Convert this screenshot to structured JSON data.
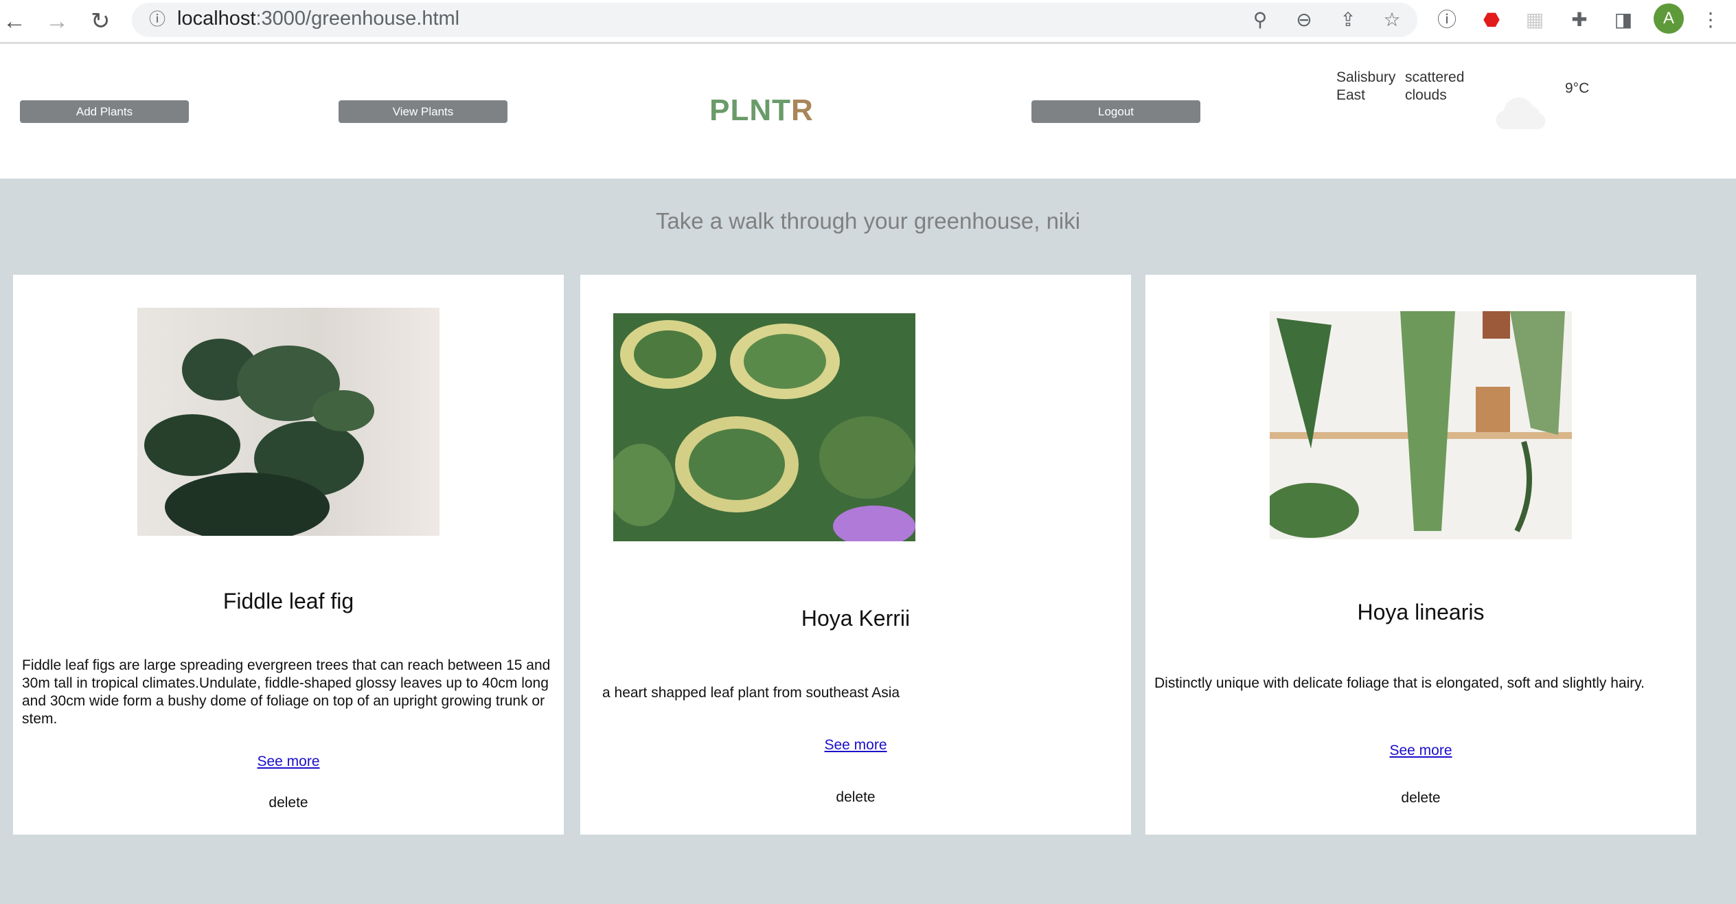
{
  "browser": {
    "url_host": "localhost",
    "url_path": ":3000/greenhouse.html",
    "profile_initial": "A"
  },
  "header": {
    "add_plants": "Add Plants",
    "view_plants": "View Plants",
    "logout": "Logout",
    "logo": {
      "part1": "PLNT",
      "part2": "R"
    },
    "weather": {
      "location_line1": "Salisbury",
      "location_line2": "East",
      "condition_line1": "scattered",
      "condition_line2": "clouds",
      "temperature": "9°C",
      "icon": "cloud-icon"
    }
  },
  "main": {
    "greeting": "Take a walk through your greenhouse, niki",
    "plants": [
      {
        "name": "Fiddle leaf fig",
        "description": "Fiddle leaf figs are large spreading evergreen trees that can reach between 15 and 30m tall in tropical climates.Undulate, fiddle-shaped glossy leaves up to 40cm long and 30cm wide form a bushy dome of foliage on top of an upright growing trunk or stem.",
        "see_more": "See more",
        "delete": "delete"
      },
      {
        "name": "Hoya Kerrii",
        "description": "a heart shapped leaf plant from southeast Asia",
        "see_more": "See more",
        "delete": "delete"
      },
      {
        "name": "Hoya linearis",
        "description": "Distinctly unique with delicate foliage that is elongated, soft and slightly hairy.",
        "see_more": "See more",
        "delete": "delete"
      }
    ]
  },
  "colors": {
    "background": "#d1d9dd",
    "button": "#7f8285",
    "logo_green": "#6a9b6a",
    "logo_brown": "#a88658",
    "link": "#1a0dcc"
  }
}
